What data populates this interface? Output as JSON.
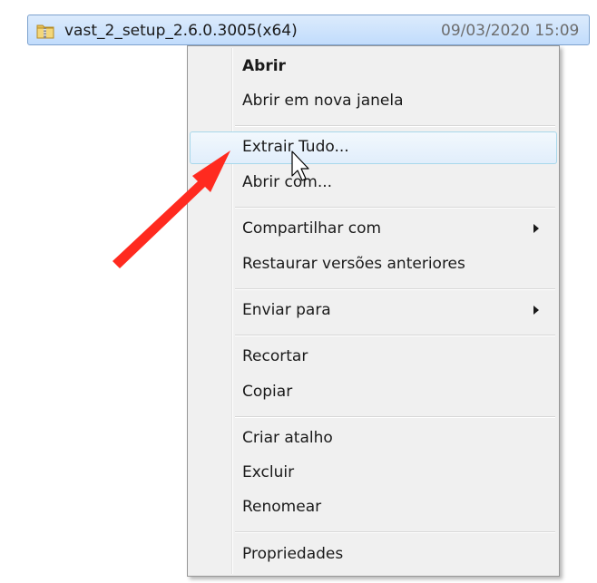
{
  "file": {
    "name": "vast_2_setup_2.6.0.3005(x64)",
    "modified": "09/03/2020 15:09",
    "icon": "zip-folder-icon"
  },
  "context_menu": {
    "items": [
      {
        "label": "Abrir"
      },
      {
        "label": "Abrir em nova janela"
      },
      {
        "label": "Extrair Tudo..."
      },
      {
        "label": "Abrir com..."
      },
      {
        "label": "Compartilhar com"
      },
      {
        "label": "Restaurar versões anteriores"
      },
      {
        "label": "Enviar para"
      },
      {
        "label": "Recortar"
      },
      {
        "label": "Copiar"
      },
      {
        "label": "Criar atalho"
      },
      {
        "label": "Excluir"
      },
      {
        "label": "Renomear"
      },
      {
        "label": "Propriedades"
      }
    ],
    "hovered_item": "Extrair Tudo...",
    "default_item": "Abrir"
  },
  "annotation": {
    "arrow_color": "#ff2a1f"
  },
  "colors": {
    "selection_bg": "#cce2fb",
    "menu_bg": "#f0f0f0",
    "hover_border": "#a8d8eb"
  }
}
